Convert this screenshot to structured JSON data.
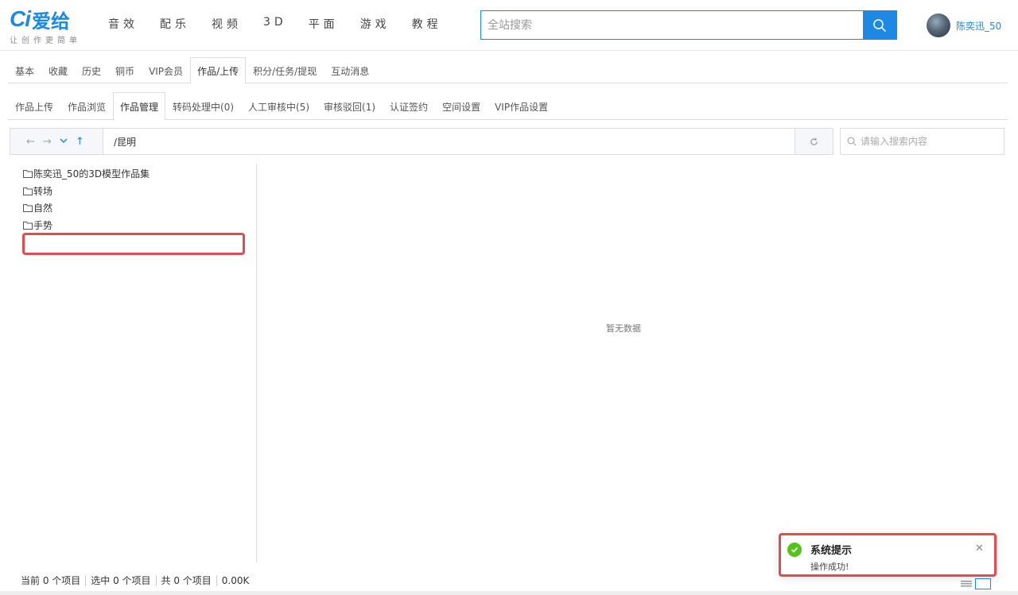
{
  "brand": {
    "logo_ci": "Ci",
    "logo_text": "爱给",
    "slogan": "让创作更简单",
    "accent": "#1e88e5"
  },
  "nav": [
    "音效",
    "配乐",
    "视频",
    "3D",
    "平面",
    "游戏",
    "教程"
  ],
  "search": {
    "placeholder": "全站搜索",
    "icon": "search-icon"
  },
  "user": {
    "name": "陈奕迅_50"
  },
  "tabs_main": [
    {
      "label": "基本",
      "active": false
    },
    {
      "label": "收藏",
      "active": false
    },
    {
      "label": "历史",
      "active": false
    },
    {
      "label": "铜币",
      "active": false
    },
    {
      "label": "VIP会员",
      "active": false
    },
    {
      "label": "作品/上传",
      "active": true
    },
    {
      "label": "积分/任务/提现",
      "active": false
    },
    {
      "label": "互动消息",
      "active": false
    }
  ],
  "tabs_sub": [
    {
      "label": "作品上传",
      "active": false
    },
    {
      "label": "作品浏览",
      "active": false
    },
    {
      "label": "作品管理",
      "active": true
    },
    {
      "label": "转码处理中(0)",
      "active": false
    },
    {
      "label": "人工审核中(5)",
      "active": false
    },
    {
      "label": "审核驳回(1)",
      "active": false
    },
    {
      "label": "认证签约",
      "active": false
    },
    {
      "label": "空间设置",
      "active": false
    },
    {
      "label": "VIP作品设置",
      "active": false
    }
  ],
  "path": {
    "current": "/昆明",
    "search_placeholder": "请输入搜索内容"
  },
  "tree": [
    {
      "label": "陈奕迅_50的3D模型作品集"
    },
    {
      "label": "转场"
    },
    {
      "label": "自然"
    },
    {
      "label": "手势"
    }
  ],
  "empty_text": "暂无数据",
  "status": {
    "current": "当前 0 个项目",
    "selected": "选中 0 个项目",
    "total": "共 0 个项目",
    "size": "0.00K"
  },
  "toast": {
    "title": "系统提示",
    "message": "操作成功!",
    "status_color": "#52c41a"
  },
  "highlight_color": "#e14d4d"
}
